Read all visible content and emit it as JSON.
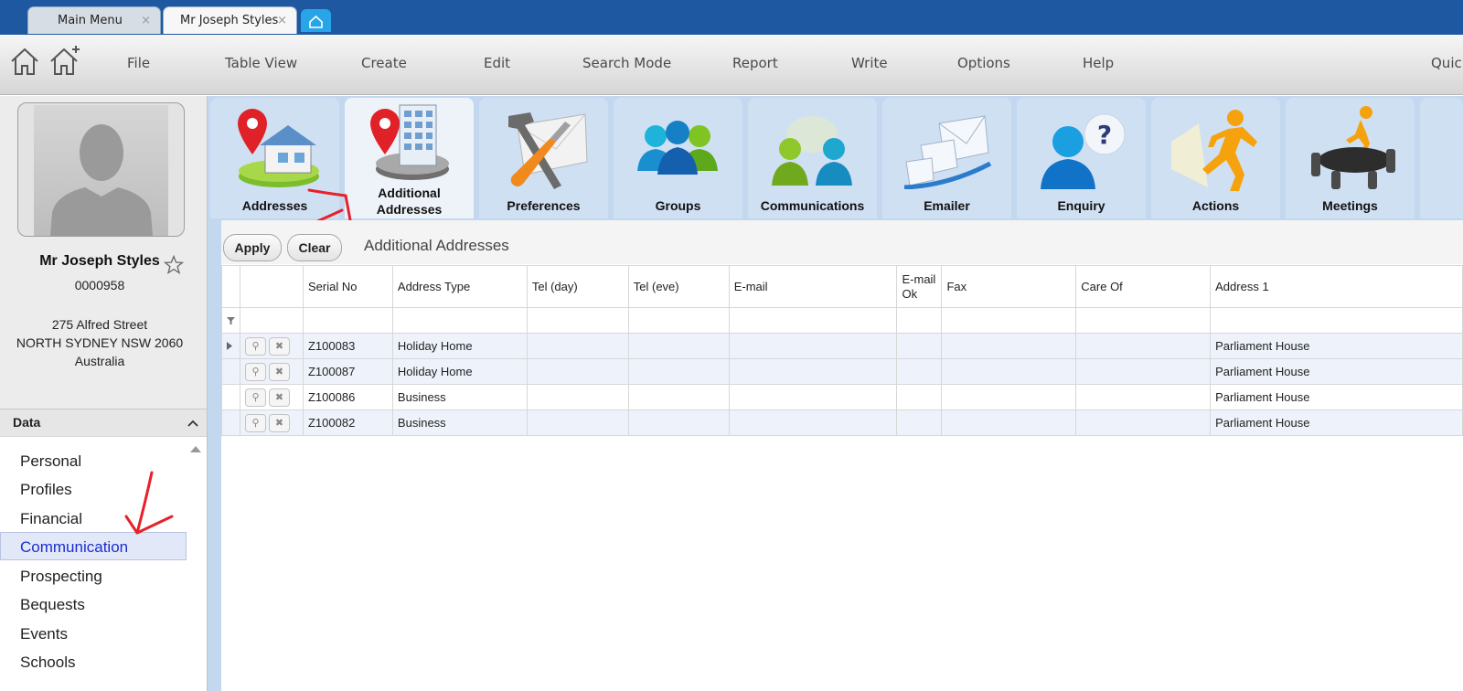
{
  "tabs": [
    {
      "label": "Main Menu"
    },
    {
      "label": "Mr Joseph Styles"
    }
  ],
  "tab_close_glyph": "×",
  "menu": [
    "File",
    "Table View",
    "Create",
    "Edit",
    "Search Mode",
    "Report",
    "Write",
    "Options",
    "Help",
    "Quic"
  ],
  "contact": {
    "name": "Mr Joseph Styles",
    "id": "0000958",
    "address_line1": "275 Alfred Street",
    "address_line2": "NORTH SYDNEY NSW 2060",
    "country": "Australia"
  },
  "data_panel": {
    "header": "Data",
    "items": [
      "Personal",
      "Profiles",
      "Financial",
      "Communication",
      "Prospecting",
      "Bequests",
      "Events",
      "Schools"
    ],
    "selected": "Communication"
  },
  "modules": [
    {
      "label": "Addresses",
      "icon": "house-pin-icon"
    },
    {
      "label": "Additional Addresses",
      "icon": "building-pin-icon",
      "active": true
    },
    {
      "label": "Preferences",
      "icon": "tools-envelope-icon"
    },
    {
      "label": "Groups",
      "icon": "people-group-icon"
    },
    {
      "label": "Communications",
      "icon": "people-chat-icon"
    },
    {
      "label": "Emailer",
      "icon": "envelopes-icon"
    },
    {
      "label": "Enquiry",
      "icon": "person-question-icon"
    },
    {
      "label": "Actions",
      "icon": "running-man-icon"
    },
    {
      "label": "Meetings",
      "icon": "meeting-table-icon"
    }
  ],
  "toolbar": {
    "apply_label": "Apply",
    "clear_label": "Clear",
    "section_title": "Additional Addresses"
  },
  "table": {
    "columns": [
      "Serial No",
      "Address Type",
      "Tel (day)",
      "Tel (eve)",
      "E-mail",
      "E-mail Ok",
      "Fax",
      "Care Of",
      "Address 1"
    ],
    "rows": [
      {
        "serial": "Z100083",
        "type": "Holiday Home",
        "address1": "Parliament House"
      },
      {
        "serial": "Z100087",
        "type": "Holiday Home",
        "address1": "Parliament House"
      },
      {
        "serial": "Z100086",
        "type": "Business",
        "address1": "Parliament House"
      },
      {
        "serial": "Z100082",
        "type": "Business",
        "address1": "Parliament House"
      }
    ]
  },
  "colors": {
    "title_bar": "#1e58a0",
    "tile_strip": "#c3d8ee",
    "annotation": "#e8202a"
  }
}
